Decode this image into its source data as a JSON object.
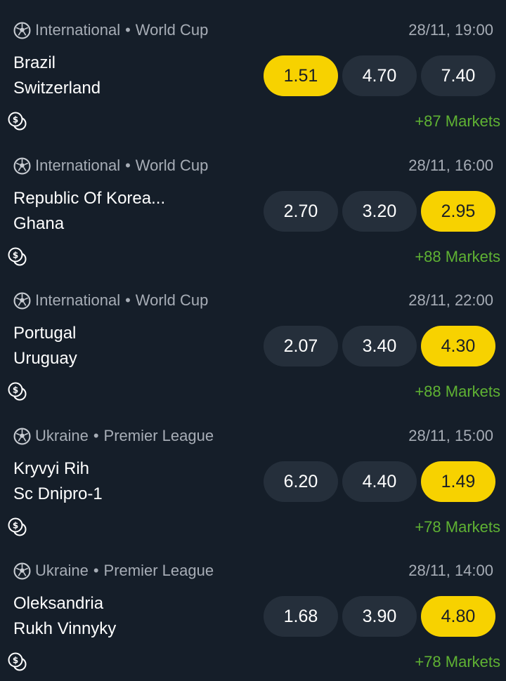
{
  "events": [
    {
      "country": "International",
      "separator": "•",
      "league": "World Cup",
      "datetime": "28/11, 19:00",
      "home": "Brazil",
      "away": "Switzerland",
      "odds": [
        "1.51",
        "4.70",
        "7.40"
      ],
      "selected": 0,
      "markets": "+87 Markets"
    },
    {
      "country": "International",
      "separator": "•",
      "league": "World Cup",
      "datetime": "28/11, 16:00",
      "home": "Republic Of Korea...",
      "away": "Ghana",
      "odds": [
        "2.70",
        "3.20",
        "2.95"
      ],
      "selected": 2,
      "markets": "+88 Markets"
    },
    {
      "country": "International",
      "separator": "•",
      "league": "World Cup",
      "datetime": "28/11, 22:00",
      "home": "Portugal",
      "away": "Uruguay",
      "odds": [
        "2.07",
        "3.40",
        "4.30"
      ],
      "selected": 2,
      "markets": "+88 Markets"
    },
    {
      "country": "Ukraine",
      "separator": "•",
      "league": "Premier League",
      "datetime": "28/11, 15:00",
      "home": "Kryvyi Rih",
      "away": "Sc Dnipro-1",
      "odds": [
        "6.20",
        "4.40",
        "1.49"
      ],
      "selected": 2,
      "markets": "+78 Markets"
    },
    {
      "country": "Ukraine",
      "separator": "•",
      "league": "Premier League",
      "datetime": "28/11, 14:00",
      "home": "Oleksandria",
      "away": "Rukh Vinnyky",
      "odds": [
        "1.68",
        "3.90",
        "4.80"
      ],
      "selected": 2,
      "markets": "+78 Markets"
    }
  ],
  "icons": {
    "sport": "soccer-ball-icon",
    "cashout": "cashout-coin-icon"
  },
  "colors": {
    "background": "#151e29",
    "odds_button": "#252f3b",
    "selected_odds": "#f7d200",
    "markets_link": "#5fb233",
    "meta_text": "#a7adb6"
  }
}
